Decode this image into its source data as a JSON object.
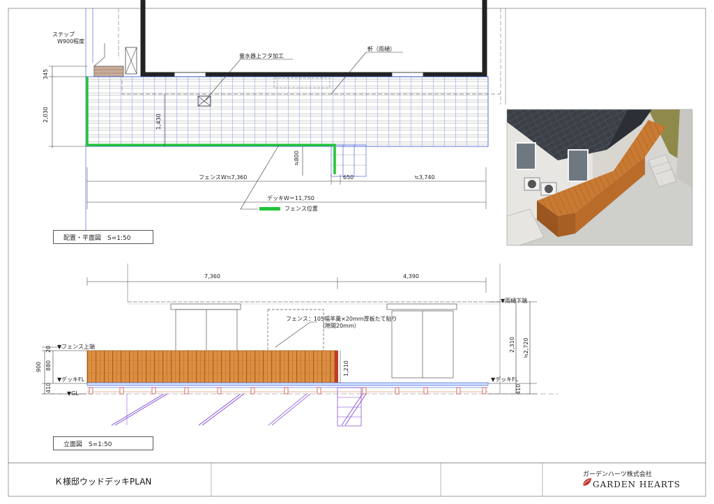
{
  "plan": {
    "labels": {
      "step": "ステップ",
      "step_size": "W900程度",
      "meter_cover": "量水器上フタ加工",
      "eaves": "軒（雨樋）",
      "fence_position": "フェンス位置"
    },
    "dims": {
      "d345": "345",
      "d2030": "2,030",
      "d1430": "1,430",
      "d800": "≒800",
      "d650": "650",
      "d3740": "≒3,740",
      "fence_w": "フェンスW≒7,360",
      "deck_w": "デッキW＝11,750"
    },
    "title": "配置・平面図　S=1:50"
  },
  "elevation": {
    "labels": {
      "fence_top": "▼フェンス上端",
      "deck_fl_left": "▼デッキFL",
      "gl": "▼GL",
      "eaves_bottom": "▼雨樋下端",
      "deck_fl_right": "▼デッキFL",
      "fence_note_1": "フェンス：105幅羊羹×20mm厚板たて貼り",
      "fence_note_2": "（隙間20mm）"
    },
    "dims": {
      "d7360": "7,360",
      "d4390": "4,390",
      "d900": "900",
      "d880": "880",
      "d20": "20",
      "d410_left": "410",
      "d1210": "1,210",
      "d2310": "2,310",
      "d2720": "≒2,720",
      "d410_right": "410"
    },
    "title": "立面図　S=1:50"
  },
  "title_block": {
    "project": "Ｋ様邸ウッドデッキPLAN",
    "company": "ガーデンハーツ株式会社",
    "brand": "GARDEN HEARTS",
    "leaf_color": "#c0392b"
  },
  "colors": {
    "deck_wood": "#d98a3c",
    "deck_wood_dark": "#b76a2a",
    "fence_green": "#22c43a",
    "grid_blue": "#2f4fd8",
    "wall": "#222222",
    "leg_purple": "#7a3fd0",
    "roof": "#3b3f46"
  }
}
